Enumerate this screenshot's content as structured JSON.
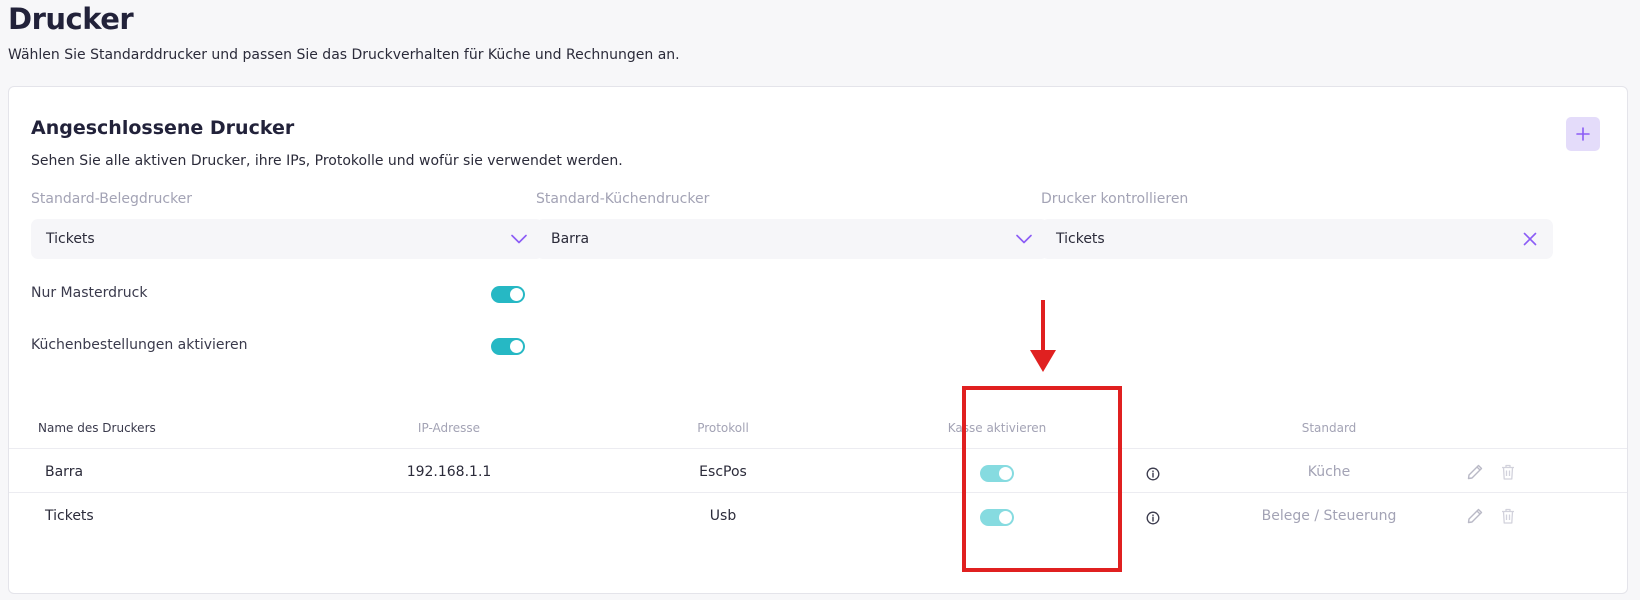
{
  "page": {
    "title": "Drucker",
    "subtitle": "Wählen Sie Standarddrucker und passen Sie das Druckverhalten für Küche und Rechnungen an."
  },
  "section": {
    "title": "Angeschlossene Drucker",
    "description": "Sehen Sie alle aktiven Drucker, ihre IPs, Protokolle und wofür sie verwendet werden.",
    "add_icon": "plus-icon"
  },
  "defaults": {
    "receipt_printer": {
      "label": "Standard-Belegdrucker",
      "value": "Tickets"
    },
    "kitchen_printer": {
      "label": "Standard-Küchendrucker",
      "value": "Barra"
    },
    "control_printer": {
      "label": "Drucker kontrollieren",
      "value": "Tickets"
    }
  },
  "toggles": {
    "master_print": {
      "label": "Nur Masterdruck",
      "on": true
    },
    "kitchen_orders": {
      "label": "Küchenbestellungen aktivieren",
      "on": true
    }
  },
  "table": {
    "headers": {
      "name": "Name des Druckers",
      "ip": "IP-Adresse",
      "protocol": "Protokoll",
      "cashier": "Kasse aktivieren",
      "standard": "Standard"
    },
    "rows": [
      {
        "name": "Barra",
        "ip": "192.168.1.1",
        "protocol": "EscPos",
        "cashier_enabled": true,
        "standard": "Küche"
      },
      {
        "name": "Tickets",
        "ip": "",
        "protocol": "Usb",
        "cashier_enabled": true,
        "standard": "Belege / Steuerung"
      }
    ]
  },
  "colors": {
    "accent": "#8b5cf6",
    "toggle_on": "#26b8c4",
    "annotation": "#e02020"
  }
}
